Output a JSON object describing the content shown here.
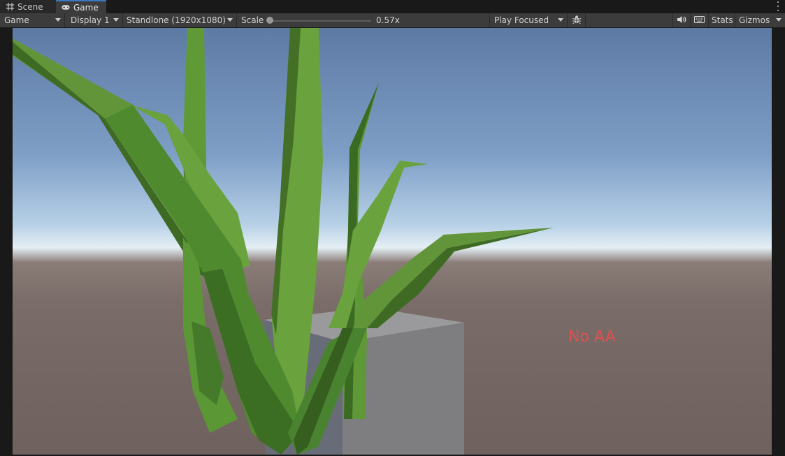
{
  "tabs": {
    "scene_label": "Scene",
    "game_label": "Game"
  },
  "toolbar": {
    "game_view": "Game",
    "display": "Display 1",
    "resolution": "Standlone (1920x1080)",
    "scale_label": "Scale",
    "scale_value": "0.57x",
    "scale_fraction": 0.0,
    "play_mode": "Play Focused",
    "stats_label": "Stats",
    "gizmos_label": "Gizmos"
  },
  "viewport": {
    "overlay_text": "No AA",
    "overlay_color": "#e25050"
  },
  "icons": {
    "scene_tab": "grid-icon",
    "game_tab": "gamepad-icon",
    "menu": "kebab-menu-icon",
    "bug": "bug-icon",
    "audio": "speaker-icon",
    "keyboard": "keyboard-icon"
  },
  "colors": {
    "accent": "#3a79bb",
    "toolbar_bg": "#3c3c3c",
    "grass_light": "#6aa03c",
    "grass_dark": "#3d6a22"
  }
}
